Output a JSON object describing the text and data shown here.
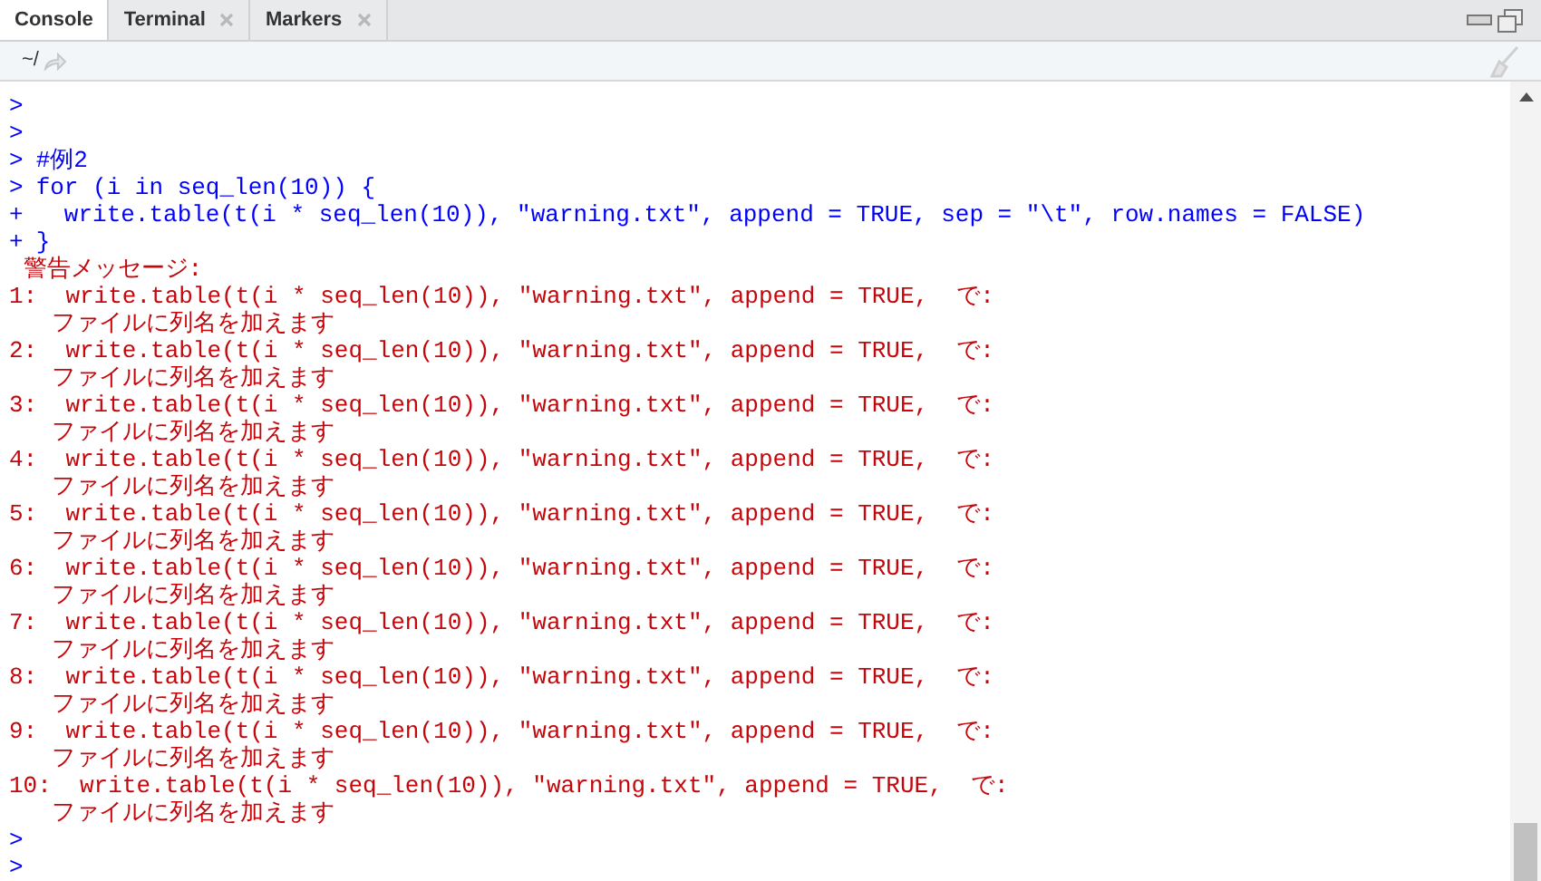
{
  "tabs": [
    {
      "label": "Console",
      "selected": true,
      "closable": false
    },
    {
      "label": "Terminal",
      "selected": false,
      "closable": true
    },
    {
      "label": "Markers",
      "selected": false,
      "closable": true
    }
  ],
  "toolbar": {
    "path": "~/"
  },
  "console": [
    {
      "kind": "input",
      "prompt": ">"
    },
    {
      "kind": "input",
      "prompt": ">"
    },
    {
      "kind": "input",
      "prompt": ">",
      "code": "#例2"
    },
    {
      "kind": "input",
      "prompt": ">",
      "code": "for (i in seq_len(10)) {"
    },
    {
      "kind": "input",
      "prompt": "+",
      "code": "  write.table(t(i * seq_len(10)), \"warning.txt\", append = TRUE, sep = \"\\t\", row.names = FALSE)"
    },
    {
      "kind": "input",
      "prompt": "+",
      "code": "}"
    },
    {
      "kind": "warning",
      "text": " 警告メッセージ:"
    },
    {
      "kind": "warning",
      "text": "1:  write.table(t(i * seq_len(10)), \"warning.txt\", append = TRUE,  で:"
    },
    {
      "kind": "warning",
      "text": "   ファイルに列名を加えます"
    },
    {
      "kind": "warning",
      "text": "2:  write.table(t(i * seq_len(10)), \"warning.txt\", append = TRUE,  で:"
    },
    {
      "kind": "warning",
      "text": "   ファイルに列名を加えます"
    },
    {
      "kind": "warning",
      "text": "3:  write.table(t(i * seq_len(10)), \"warning.txt\", append = TRUE,  で:"
    },
    {
      "kind": "warning",
      "text": "   ファイルに列名を加えます"
    },
    {
      "kind": "warning",
      "text": "4:  write.table(t(i * seq_len(10)), \"warning.txt\", append = TRUE,  で:"
    },
    {
      "kind": "warning",
      "text": "   ファイルに列名を加えます"
    },
    {
      "kind": "warning",
      "text": "5:  write.table(t(i * seq_len(10)), \"warning.txt\", append = TRUE,  で:"
    },
    {
      "kind": "warning",
      "text": "   ファイルに列名を加えます"
    },
    {
      "kind": "warning",
      "text": "6:  write.table(t(i * seq_len(10)), \"warning.txt\", append = TRUE,  で:"
    },
    {
      "kind": "warning",
      "text": "   ファイルに列名を加えます"
    },
    {
      "kind": "warning",
      "text": "7:  write.table(t(i * seq_len(10)), \"warning.txt\", append = TRUE,  で:"
    },
    {
      "kind": "warning",
      "text": "   ファイルに列名を加えます"
    },
    {
      "kind": "warning",
      "text": "8:  write.table(t(i * seq_len(10)), \"warning.txt\", append = TRUE,  で:"
    },
    {
      "kind": "warning",
      "text": "   ファイルに列名を加えます"
    },
    {
      "kind": "warning",
      "text": "9:  write.table(t(i * seq_len(10)), \"warning.txt\", append = TRUE,  で:"
    },
    {
      "kind": "warning",
      "text": "   ファイルに列名を加えます"
    },
    {
      "kind": "warning",
      "text": "10:  write.table(t(i * seq_len(10)), \"warning.txt\", append = TRUE,  で:"
    },
    {
      "kind": "warning",
      "text": "   ファイルに列名を加えます"
    },
    {
      "kind": "input",
      "prompt": ">"
    },
    {
      "kind": "input",
      "prompt": ">"
    }
  ]
}
